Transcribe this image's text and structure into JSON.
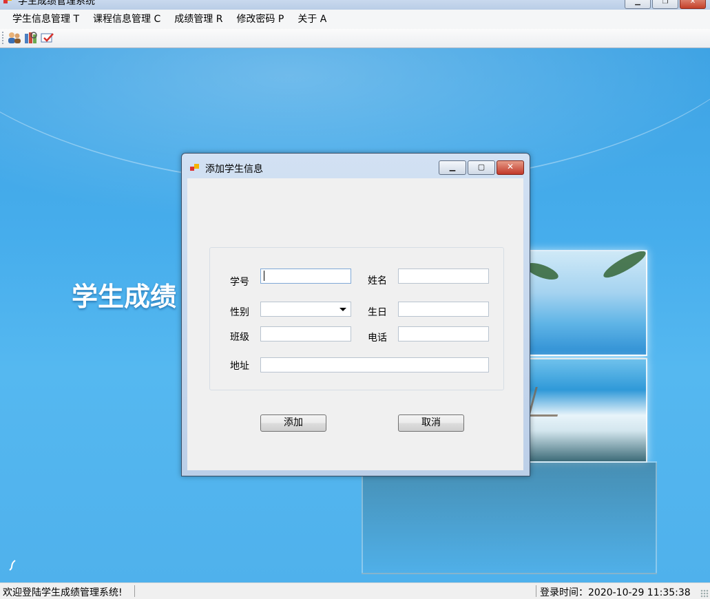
{
  "main_window": {
    "title": "学生成绩管理系统",
    "menu": [
      {
        "label": "学生信息管理 T"
      },
      {
        "label": "课程信息管理 C"
      },
      {
        "label": "成绩管理 R"
      },
      {
        "label": "修改密码 P"
      },
      {
        "label": "关于 A"
      }
    ],
    "toolbar_icons": [
      "user-manage-icon",
      "course-books-icon",
      "grade-check-icon"
    ]
  },
  "desktop": {
    "headline": "学生成绩"
  },
  "dialog": {
    "title": "添加学生信息",
    "fields": {
      "student_id": {
        "label": "学号",
        "value": ""
      },
      "name": {
        "label": "姓名",
        "value": ""
      },
      "gender": {
        "label": "性别",
        "value": ""
      },
      "birthday": {
        "label": "生日",
        "value": ""
      },
      "class": {
        "label": "班级",
        "value": ""
      },
      "phone": {
        "label": "电话",
        "value": ""
      },
      "address": {
        "label": "地址",
        "value": ""
      }
    },
    "buttons": {
      "add": "添加",
      "cancel": "取消"
    }
  },
  "statusbar": {
    "welcome": "欢迎登陆学生成绩管理系统!",
    "login_time": "登录时间：2020-10-29 11:35:38"
  },
  "colors": {
    "desktop_blue": "#46adec",
    "dialog_frame": "#bccfe8",
    "close_red": "#c1382a"
  }
}
